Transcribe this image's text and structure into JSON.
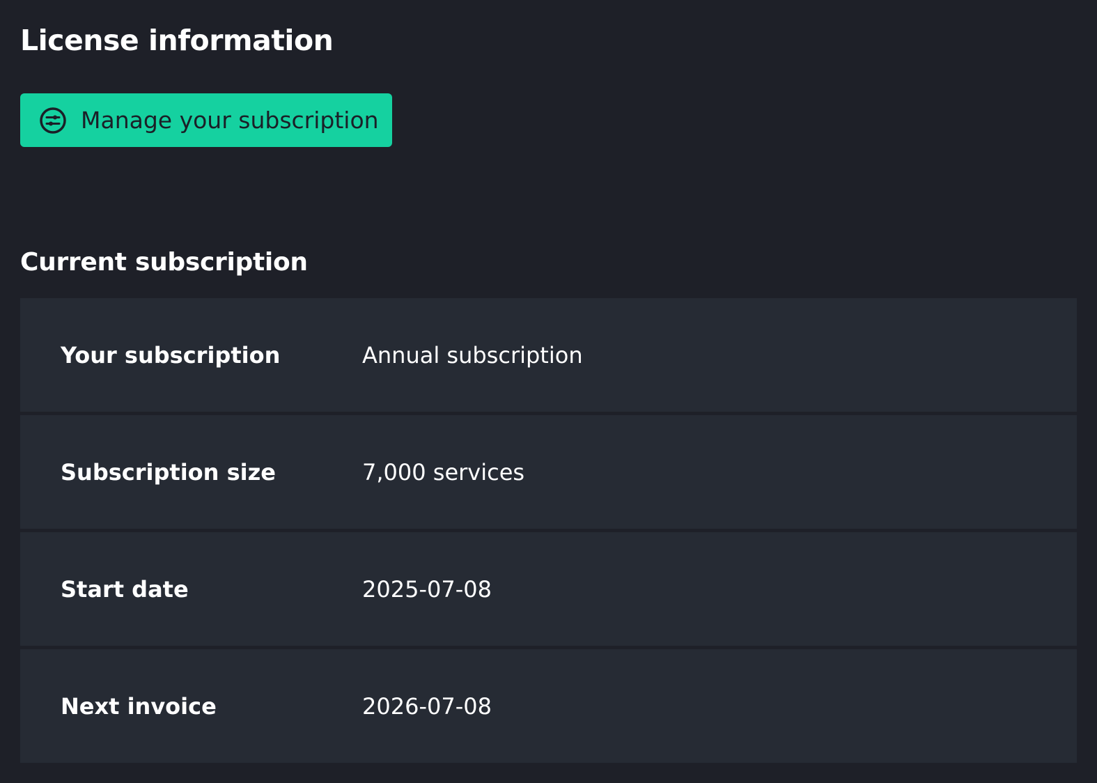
{
  "page": {
    "title": "License information"
  },
  "manage_button": {
    "label": "Manage your subscription",
    "icon": "sliders-circle-icon",
    "color": "#15d1a0"
  },
  "current_subscription": {
    "heading": "Current subscription",
    "rows": [
      {
        "label": "Your subscription",
        "value": "Annual subscription"
      },
      {
        "label": "Subscription size",
        "value": "7,000 services"
      },
      {
        "label": "Start date",
        "value": "2025-07-08"
      },
      {
        "label": "Next invoice",
        "value": "2026-07-08"
      }
    ]
  }
}
